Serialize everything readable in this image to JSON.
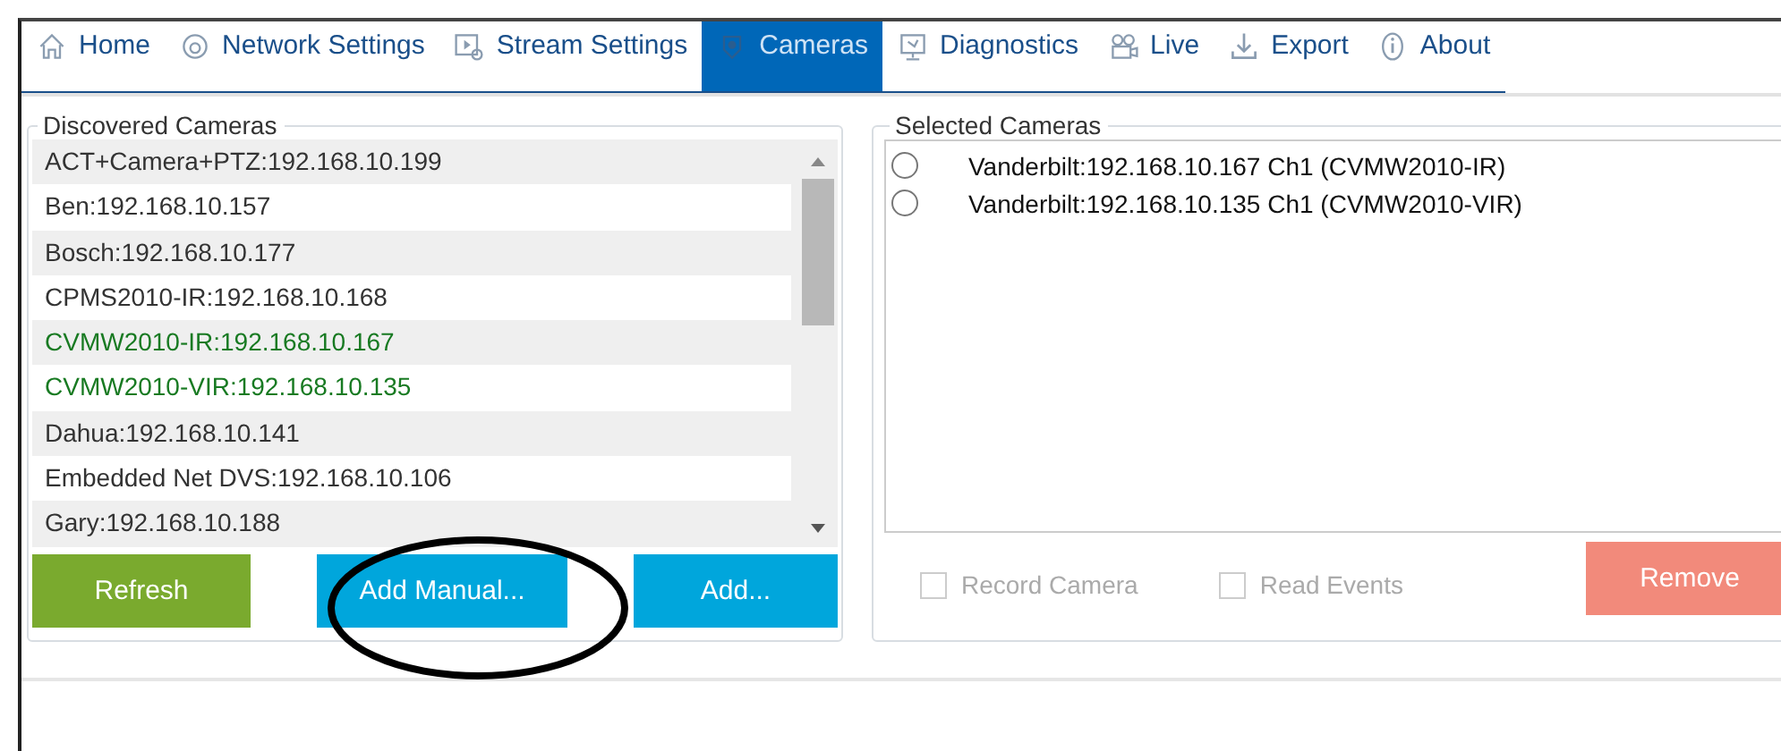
{
  "tabs": [
    {
      "label": "Home",
      "kind": "home",
      "selected": false
    },
    {
      "label": "Network Settings",
      "kind": "network",
      "selected": false
    },
    {
      "label": "Stream Settings",
      "kind": "stream",
      "selected": false
    },
    {
      "label": "Cameras",
      "kind": "camera",
      "selected": true
    },
    {
      "label": "Diagnostics",
      "kind": "monitor",
      "selected": false
    },
    {
      "label": "Live",
      "kind": "video",
      "selected": false
    },
    {
      "label": "Export",
      "kind": "download",
      "selected": false
    },
    {
      "label": "About",
      "kind": "info",
      "selected": false
    }
  ],
  "discovered": {
    "title": "Discovered Cameras",
    "items": [
      {
        "label": "ACT+Camera+PTZ:192.168.10.199",
        "added": false
      },
      {
        "label": "Ben:192.168.10.157",
        "added": false
      },
      {
        "label": "Bosch:192.168.10.177",
        "added": false
      },
      {
        "label": "CPMS2010-IR:192.168.10.168",
        "added": false
      },
      {
        "label": "CVMW2010-IR:192.168.10.167",
        "added": true
      },
      {
        "label": "CVMW2010-VIR:192.168.10.135",
        "added": true
      },
      {
        "label": "Dahua:192.168.10.141",
        "added": false
      },
      {
        "label": "Embedded Net DVS:192.168.10.106",
        "added": false
      },
      {
        "label": "Gary:192.168.10.188",
        "added": false
      }
    ],
    "buttons": [
      {
        "label": "Refresh",
        "kind": "green"
      },
      {
        "label": "Add Manual...",
        "kind": "blue"
      },
      {
        "label": "Add...",
        "kind": "blue"
      }
    ]
  },
  "selected": {
    "title": "Selected Cameras",
    "items": [
      {
        "label": "Vanderbilt:192.168.10.167 Ch1 (CVMW2010-IR)",
        "selected": false
      },
      {
        "label": "Vanderbilt:192.168.10.135 Ch1 (CVMW2010-VIR)",
        "selected": false
      }
    ],
    "options": [
      {
        "label": "Record Camera",
        "checked": false,
        "disabled": true
      },
      {
        "label": "Read Events",
        "checked": false,
        "disabled": true
      }
    ],
    "remove_button": {
      "label": "Remove"
    }
  }
}
